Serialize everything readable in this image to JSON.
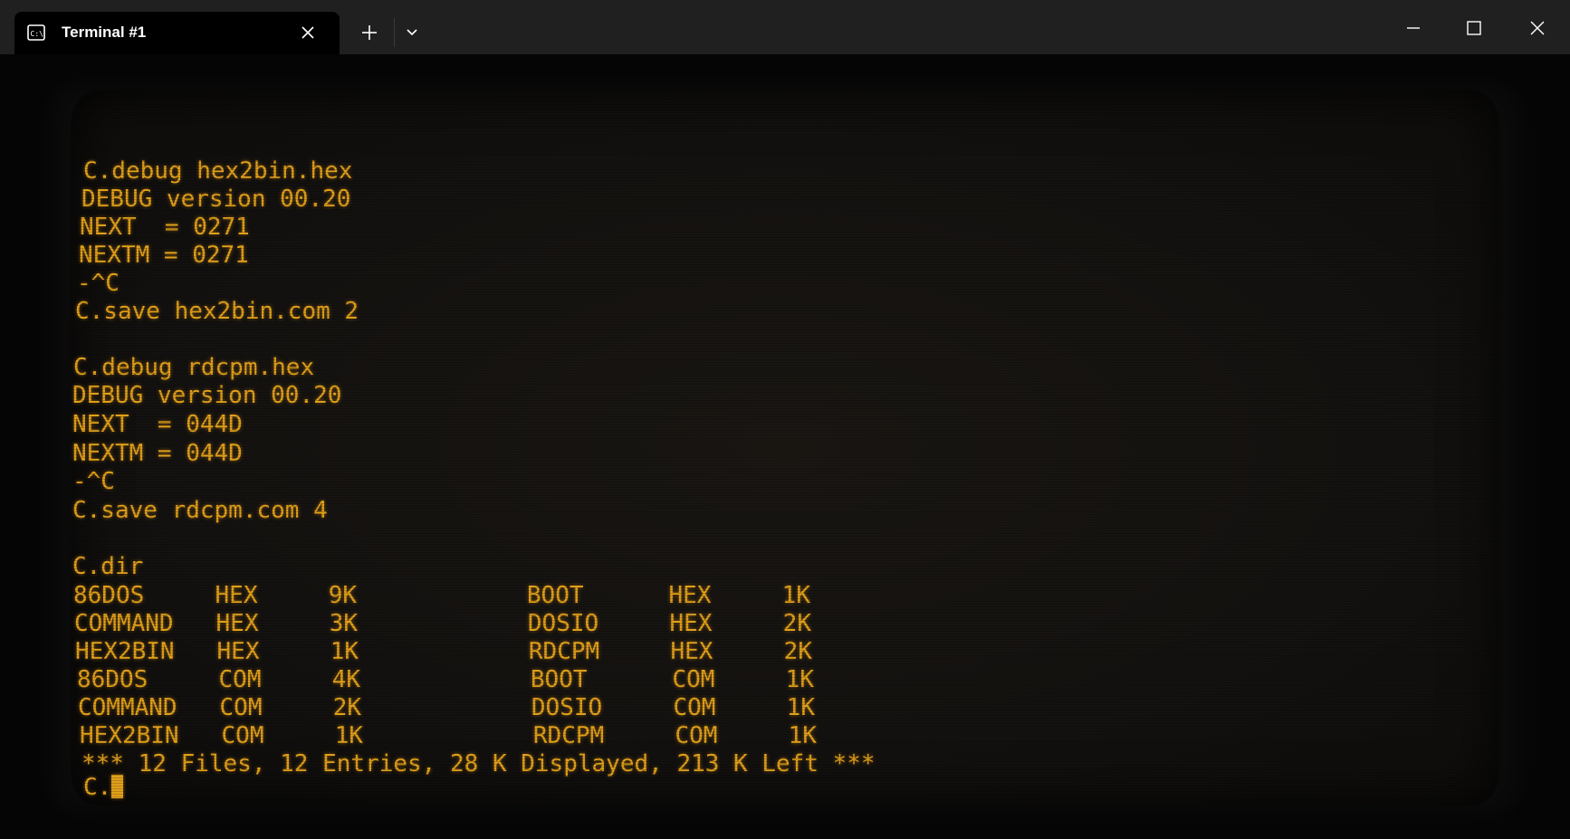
{
  "titlebar": {
    "tab_title": "Terminal #1",
    "icons": {
      "tab_icon": "terminal-icon",
      "tab_close": "close-icon",
      "new_tab": "plus-icon",
      "dropdown": "chevron-down-icon",
      "minimize": "minimize-icon",
      "maximize": "maximize-icon",
      "close": "close-icon"
    }
  },
  "terminal": {
    "text_color": "#e0a01a",
    "lines": [
      "C.debug hex2bin.hex",
      "DEBUG version 00.20",
      "NEXT  = 0271",
      "NEXTM = 0271",
      "-^C",
      "C.save hex2bin.com 2",
      "",
      "C.debug rdcpm.hex",
      "DEBUG version 00.20",
      "NEXT  = 044D",
      "NEXTM = 044D",
      "-^C",
      "C.save rdcpm.com 4",
      "",
      "C.dir",
      "86DOS     HEX     9K            BOOT      HEX     1K",
      "COMMAND   HEX     3K            DOSIO     HEX     2K",
      "HEX2BIN   HEX     1K            RDCPM     HEX     2K",
      "86DOS     COM     4K            BOOT      COM     1K",
      "COMMAND   COM     2K            DOSIO     COM     1K",
      "HEX2BIN   COM     1K            RDCPM     COM     1K",
      "*** 12 Files, 12 Entries, 28 K Displayed, 213 K Left ***"
    ],
    "prompt": "C."
  }
}
